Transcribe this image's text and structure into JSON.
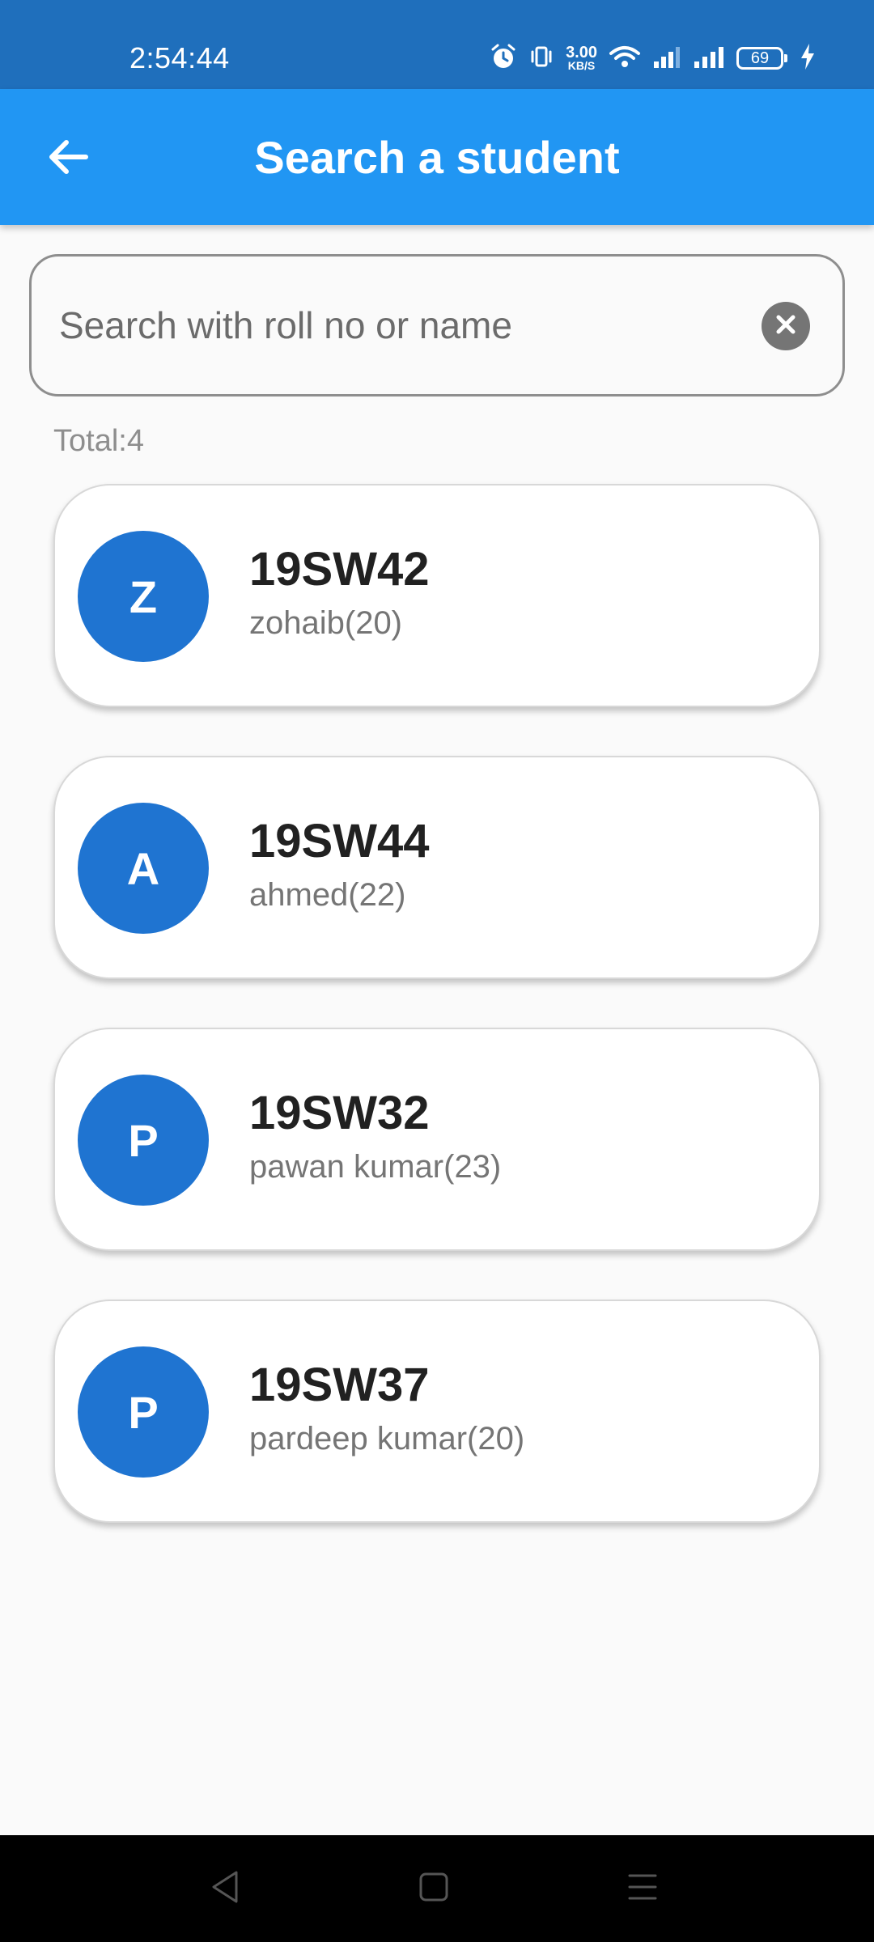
{
  "status_bar": {
    "time": "2:54:44",
    "network_speed": "3.00",
    "network_speed_unit": "KB/S",
    "battery_level": "69",
    "icons": [
      "alarm-icon",
      "vibrate-icon",
      "wifi-icon",
      "signal-icon",
      "signal-icon",
      "battery-icon",
      "charging-icon"
    ]
  },
  "app_bar": {
    "title": "Search a student",
    "back_icon": "arrow-left-icon"
  },
  "search": {
    "placeholder": "Search with roll no or name",
    "value": "",
    "clear_icon": "close-circle-icon"
  },
  "total_label": "Total:4",
  "students": [
    {
      "initial": "Z",
      "roll": "19SW42",
      "name": "zohaib(20)"
    },
    {
      "initial": "A",
      "roll": "19SW44",
      "name": "ahmed(22)"
    },
    {
      "initial": "P",
      "roll": "19SW32",
      "name": "pawan kumar(23)"
    },
    {
      "initial": "P",
      "roll": "19SW37",
      "name": "pardeep kumar(20)"
    }
  ],
  "nav_bar": {
    "icons": [
      "back-triangle-icon",
      "home-square-icon",
      "menu-lines-icon"
    ]
  },
  "colors": {
    "status_bar": "#1f6fbc",
    "app_bar": "#2196f3",
    "avatar": "#1f74d1",
    "background": "#fafafa"
  }
}
